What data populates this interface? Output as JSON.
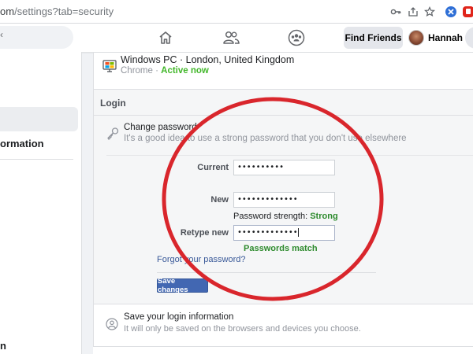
{
  "browser": {
    "url_host": "om",
    "url_path": "/settings?tab=security"
  },
  "nav": {
    "find_friends": "Find Friends",
    "user_name": "Hannah"
  },
  "sidebar": {
    "item_1": "ormation",
    "item_2": "n"
  },
  "device": {
    "name": "Windows PC · London, United Kingdom",
    "browser": "Chrome",
    "separator": " · ",
    "status": "Active now"
  },
  "login": {
    "title": "Login",
    "change_password": {
      "title": "Change password",
      "description": "It's a good idea to use a strong password that you don't use elsewhere",
      "current_label": "Current",
      "current_value": "••••••••••",
      "new_label": "New",
      "new_value": "•••••••••••••",
      "strength_label": "Password strength: ",
      "strength_value": "Strong",
      "retype_label": "Retype new",
      "retype_value": "•••••••••••••",
      "match_text": "Passwords match",
      "forgot_link": "Forgot your password?",
      "save_button": "Save changes"
    },
    "save_login": {
      "title": "Save your login information",
      "description": "It will only be saved on the browsers and devices you choose."
    }
  },
  "colors": {
    "accent": "#4267b2",
    "active_green": "#42b72a",
    "annotation_red": "#d9262c"
  }
}
